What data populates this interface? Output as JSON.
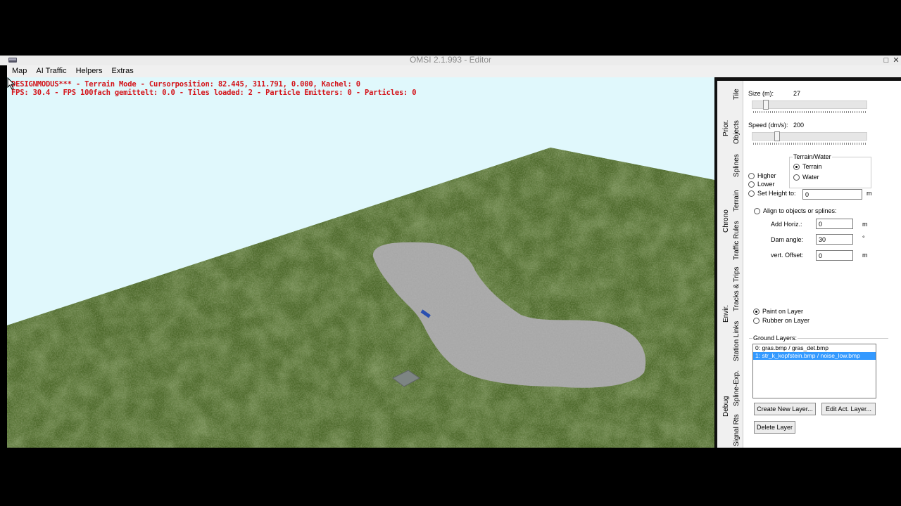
{
  "window": {
    "title": "OMSI 2.1.993 - Editor"
  },
  "menu": [
    "Map",
    "AI Traffic",
    "Helpers",
    "Extras"
  ],
  "hud": {
    "line1": "DESIGNMODUS*** - Terrain Mode - Cursorposition: 82.445, 311.791, 0.000, Kachel: 0",
    "line2": "FPS: 30.4 - FPS 100fach gemittelt: 0.0 - Tiles loaded: 2 - Particle Emitters: 0 - Particles: 0"
  },
  "tabs": [
    "Tile",
    "Prior.",
    "Objects",
    "Splines",
    "Terrain",
    "Chrono",
    "Traffic Rules",
    "Tracks & Trips",
    "Envir.",
    "Station Links",
    "Spline-Exp.",
    "Debug",
    "Signal Rts"
  ],
  "terrain_panel": {
    "size_label": "Size (m):",
    "size_value": "27",
    "size_level": 0.1,
    "speed_label": "Speed (dm/s):",
    "speed_value": "200",
    "speed_level": 0.2,
    "mode_options": {
      "higher": "Higher",
      "lower": "Lower",
      "set_height": "Set Height to:"
    },
    "set_height_value": "0",
    "set_height_unit": "m",
    "terrain_water": {
      "title": "Terrain/Water",
      "terrain": "Terrain",
      "water": "Water",
      "selected": "Terrain"
    },
    "align_label": "Align to objects or splines:",
    "add_horiz": {
      "label": "Add Horiz.:",
      "value": "0",
      "unit": "m"
    },
    "dam_angle": {
      "label": "Dam angle:",
      "value": "30",
      "unit": "°"
    },
    "vert_offset": {
      "label": "vert. Offset:",
      "value": "0",
      "unit": "m"
    },
    "paint_on_layer": "Paint on Layer",
    "rubber_on_layer": "Rubber on Layer",
    "paint_mode_selected": "Paint on Layer",
    "ground_layers_label": "Ground Layers:",
    "ground_layers": [
      "0: gras.bmp / gras_det.bmp",
      "1: str_k_kopfstein.bmp / noise_low.bmp"
    ],
    "selected_layer": 1,
    "buttons": {
      "create": "Create New Layer...",
      "edit": "Edit Act. Layer...",
      "delete": "Delete Layer"
    }
  },
  "colors": {
    "sky": "#e0f8fc",
    "grass": "#4e6a2c",
    "paint": "#a8a8a8",
    "hud_text": "#d4141a",
    "selection": "#3399ff"
  }
}
